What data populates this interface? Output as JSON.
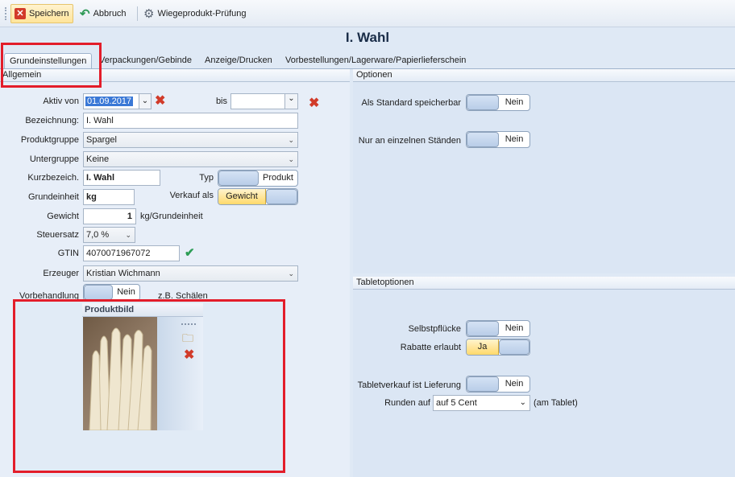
{
  "toolbar": {
    "save_label": "Speichern",
    "cancel_label": "Abbruch",
    "check_label": "Wiegeprodukt-Prüfung"
  },
  "title": "I. Wahl",
  "tabs": [
    {
      "label": "Grundeinstellungen"
    },
    {
      "label": "Verpackungen/Gebinde"
    },
    {
      "label": "Anzeige/Drucken"
    },
    {
      "label": "Vorbestellungen/Lagerware/Papierlieferschein"
    }
  ],
  "general": {
    "header": "Allgemein",
    "active_from_label": "Aktiv von",
    "active_from_value": "01.09.2017",
    "to_label": "bis",
    "to_value": "",
    "name_label": "Bezeichnung:",
    "name_value": "I. Wahl",
    "group_label": "Produktgruppe",
    "group_value": "Spargel",
    "subgroup_label": "Untergruppe",
    "subgroup_value": "Keine",
    "short_label": "Kurzbezeich.",
    "short_value": "I. Wahl",
    "type_label": "Typ",
    "type_value": "Produkt",
    "unit_label": "Grundeinheit",
    "unit_value": "kg",
    "sale_label": "Verkauf als",
    "sale_value": "Gewicht",
    "weight_label": "Gewicht",
    "weight_value": "1",
    "weight_unit": "kg/Grundeinheit",
    "tax_label": "Steuersatz",
    "tax_value": "7,0 %",
    "gtin_label": "GTIN",
    "gtin_value": "4070071967072",
    "producer_label": "Erzeuger",
    "producer_value": "Kristian Wichmann",
    "pretreat_label": "Vorbehandlung",
    "pretreat_value": "Nein",
    "pretreat_hint": "z.B. Schälen",
    "image_label": "Produktbild"
  },
  "options": {
    "header": "Optionen",
    "standard_label": "Als Standard speicherbar",
    "standard_value": "Nein",
    "stands_label": "Nur an einzelnen Ständen",
    "stands_value": "Nein"
  },
  "tablet": {
    "header": "Tabletoptionen",
    "selfpick_label": "Selbstpflücke",
    "selfpick_value": "Nein",
    "discount_label": "Rabatte erlaubt",
    "discount_value": "Ja",
    "delivery_label": "Tabletverkauf ist Lieferung",
    "delivery_value": "Nein",
    "round_label": "Runden auf",
    "round_value": "auf 5 Cent",
    "round_hint": "(am Tablet)"
  },
  "colors": {
    "highlight_frame": "#e31d2a",
    "toggle_on": "#ffd96b",
    "toggle_knob": "#b9cde8"
  }
}
